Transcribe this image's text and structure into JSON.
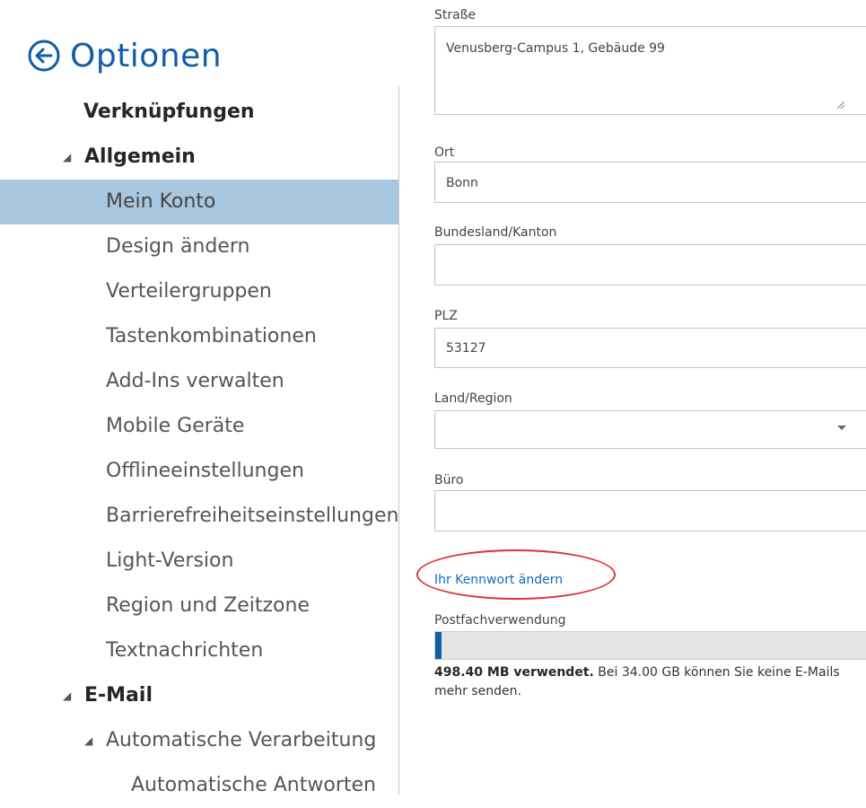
{
  "header": {
    "title": "Optionen",
    "back_icon": "arrow-left-circle-icon"
  },
  "colors": {
    "accent": "#0f5ea8",
    "selected_bg": "#a9c7df",
    "link": "#0f6cbd",
    "highlight": "#e0303a"
  },
  "nav": {
    "shortcuts": "Verknüpfungen",
    "general": "Allgemein",
    "items": [
      "Mein Konto",
      "Design ändern",
      "Verteilergruppen",
      "Tastenkombinationen",
      "Add-Ins verwalten",
      "Mobile Geräte",
      "Offlineeinstellungen",
      "Barrierefreiheitseinstellungen",
      "Light-Version",
      "Region und Zeitzone",
      "Textnachrichten"
    ],
    "email": "E-Mail",
    "auto_processing": "Automatische Verarbeitung",
    "auto_replies": "Automatische Antworten"
  },
  "form": {
    "street": {
      "label": "Straße",
      "value": "Venusberg-Campus 1, Gebäude 99"
    },
    "city": {
      "label": "Ort",
      "value": "Bonn"
    },
    "state": {
      "label": "Bundesland/Kanton",
      "value": ""
    },
    "zip": {
      "label": "PLZ",
      "value": "53127"
    },
    "country": {
      "label": "Land/Region",
      "value": ""
    },
    "office": {
      "label": "Büro",
      "value": ""
    },
    "change_password_link": "Ihr Kennwort ändern",
    "mailbox_usage_label": "Postfachverwendung",
    "usage_fraction": 0.0143,
    "usage_used": "498.40 MB verwendet.",
    "usage_rest": " Bei 34.00 GB können Sie keine E-Mails mehr senden."
  }
}
